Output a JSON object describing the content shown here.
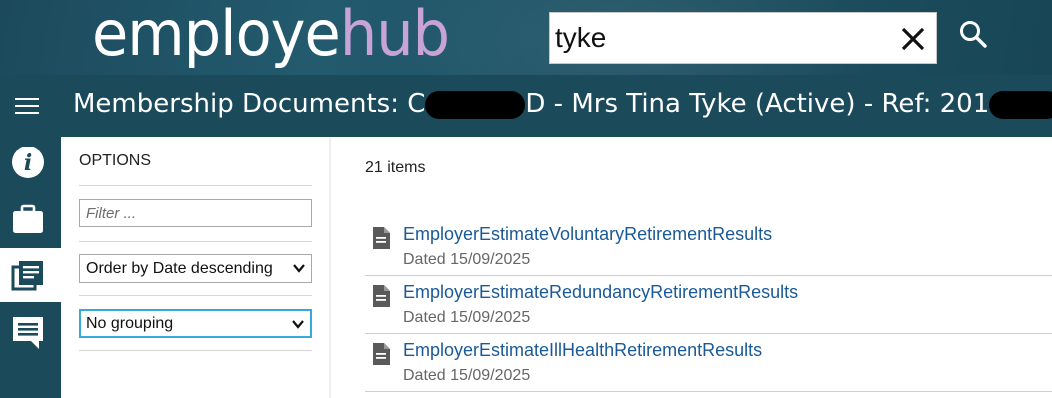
{
  "brand": {
    "logo_part1": "employe",
    "logo_part2": "hub"
  },
  "search": {
    "value": "tyke",
    "clear_icon": "close-icon",
    "search_icon": "search-icon"
  },
  "titlebar": {
    "menu_icon": "hamburger-menu-icon",
    "title_part1": "Membership Documents: C",
    "title_part2": "D - Mrs Tina Tyke (Active) - Ref: 201"
  },
  "rail": {
    "items": [
      {
        "icon": "info-icon",
        "active": false
      },
      {
        "icon": "briefcase-icon",
        "active": false
      },
      {
        "icon": "documents-icon",
        "active": true
      },
      {
        "icon": "chat-icon",
        "active": false
      }
    ]
  },
  "options": {
    "title": "OPTIONS",
    "filter_placeholder": "Filter ...",
    "order_value": "Order by Date descending",
    "grouping_value": "No grouping"
  },
  "content": {
    "count_label": "21 items",
    "documents": [
      {
        "name": "EmployerEstimateVoluntaryRetirementResults",
        "date": "Dated 15/09/2025"
      },
      {
        "name": "EmployerEstimateRedundancyRetirementResults",
        "date": "Dated 15/09/2025"
      },
      {
        "name": "EmployerEstimateIllHealthRetirementResults",
        "date": "Dated 15/09/2025"
      }
    ]
  },
  "colors": {
    "header_bg": "#1b4a5b",
    "logo_accent": "#c7a3d6",
    "link": "#1a5a96",
    "focus_border": "#3aa8d8"
  }
}
